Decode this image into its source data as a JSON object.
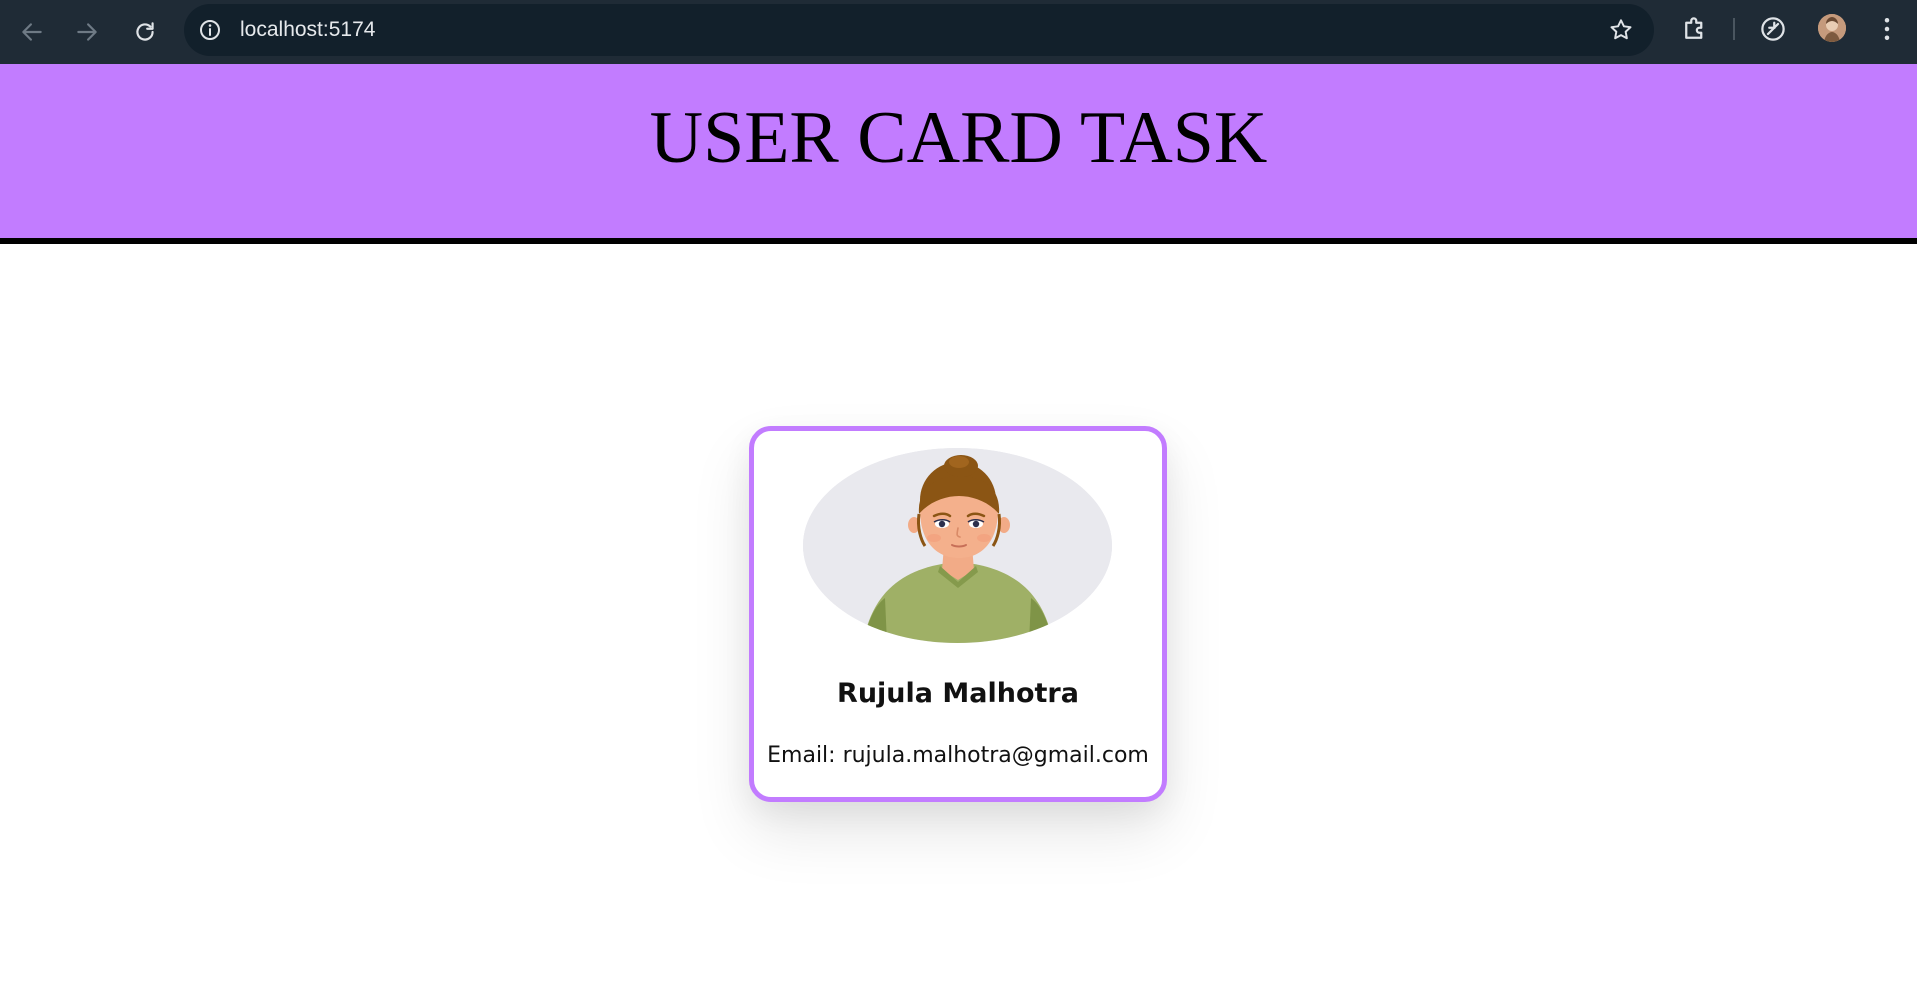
{
  "browser": {
    "url": "localhost:5174",
    "icons": {
      "back": "arrow-left-icon",
      "forward": "arrow-right-icon",
      "reload": "reload-icon",
      "site_info": "info-icon",
      "bookmark": "star-icon",
      "extensions": "puzzle-icon",
      "performance": "leaf-icon",
      "profile": "avatar",
      "menu": "kebab-menu-icon"
    }
  },
  "header": {
    "title": "USER CARD TASK",
    "background": "#c27cff",
    "border_color": "#000000"
  },
  "card": {
    "name": "Rujula Malhotra",
    "email_text": "Email: rujula.malhotra@gmail.com",
    "border_color": "#c27cff",
    "photo": "female-avatar-illustration"
  }
}
